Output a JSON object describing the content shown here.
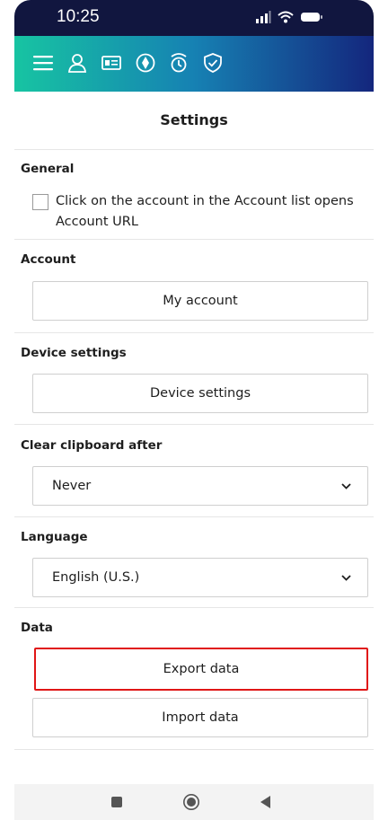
{
  "status_bar": {
    "time": "10:25",
    "icons": [
      "signal-icon",
      "wifi-icon",
      "battery-icon"
    ]
  },
  "header": {
    "icons": [
      "menu-icon",
      "user-icon",
      "id-card-icon",
      "palette-icon",
      "stopwatch-icon",
      "shield-check-icon"
    ],
    "gradient": [
      "#17c4a2",
      "#1681b3",
      "#14267d"
    ]
  },
  "settings": {
    "title": "Settings",
    "general": {
      "title": "General",
      "checkbox_label": "Click on the account in the Account list opens Account URL",
      "checked": false
    },
    "account": {
      "title": "Account",
      "button_label": "My account"
    },
    "device": {
      "title": "Device settings",
      "button_label": "Device settings"
    },
    "clipboard": {
      "title": "Clear clipboard after",
      "selected": "Never"
    },
    "language": {
      "title": "Language",
      "selected": "English (U.S.)"
    },
    "data": {
      "title": "Data",
      "export_label": "Export data",
      "import_label": "Import data"
    }
  },
  "nav_bar": {
    "buttons": [
      "recents-icon",
      "home-icon",
      "back-icon"
    ]
  },
  "colors": {
    "highlight_border": "#e01616",
    "divider": "#e6e6e6",
    "status_bar_bg": "#11163f"
  }
}
